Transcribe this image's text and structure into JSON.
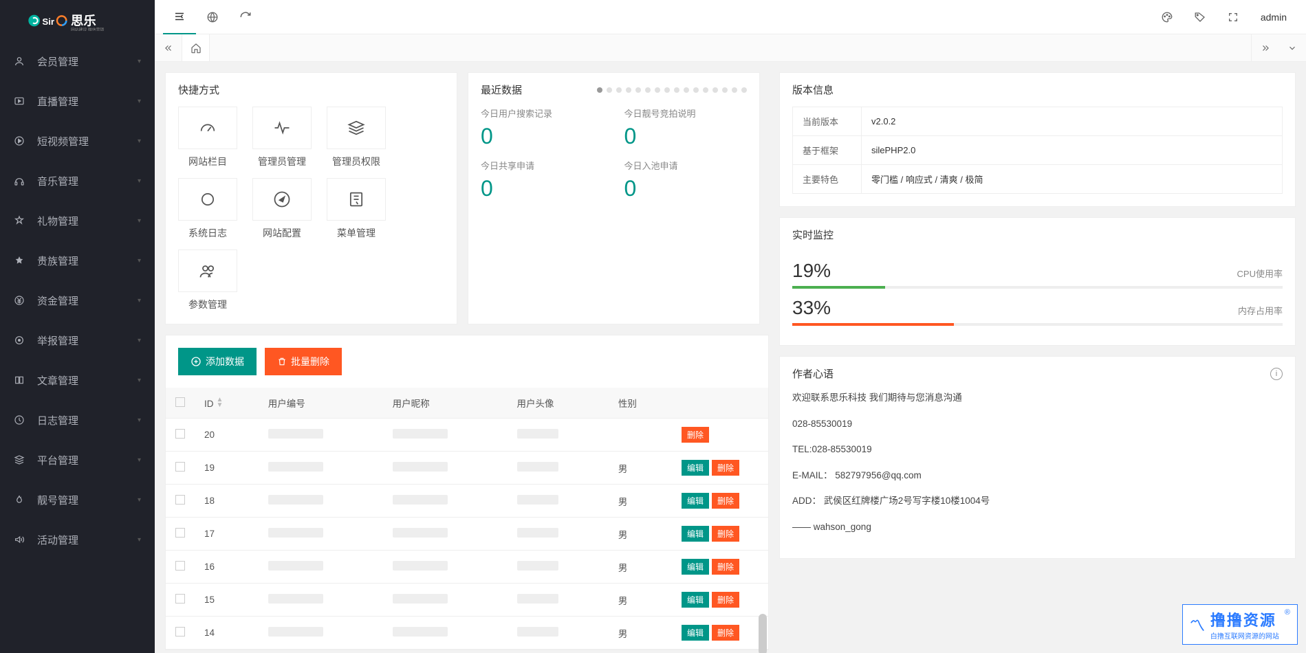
{
  "brand": {
    "name": "思乐",
    "sub": "网站建设 微信营销"
  },
  "nav": [
    {
      "icon": "user",
      "label": "会员管理"
    },
    {
      "icon": "play",
      "label": "直播管理"
    },
    {
      "icon": "video",
      "label": "短视频管理"
    },
    {
      "icon": "music",
      "label": "音乐管理"
    },
    {
      "icon": "gift",
      "label": "礼物管理"
    },
    {
      "icon": "star",
      "label": "贵族管理"
    },
    {
      "icon": "yen",
      "label": "资金管理"
    },
    {
      "icon": "report",
      "label": "举报管理"
    },
    {
      "icon": "article",
      "label": "文章管理"
    },
    {
      "icon": "log",
      "label": "日志管理"
    },
    {
      "icon": "platform",
      "label": "平台管理"
    },
    {
      "icon": "fire",
      "label": "靓号管理"
    },
    {
      "icon": "sound",
      "label": "活动管理"
    }
  ],
  "topbar": {
    "user": "admin"
  },
  "quick": {
    "title": "快捷方式",
    "items": [
      {
        "label": "网站栏目",
        "icon": "gauge"
      },
      {
        "label": "管理员管理",
        "icon": "pulse"
      },
      {
        "label": "管理员权限",
        "icon": "layers"
      },
      {
        "label": "系统日志",
        "icon": "circle"
      },
      {
        "label": "网站配置",
        "icon": "compass"
      },
      {
        "label": "菜单管理",
        "icon": "note"
      },
      {
        "label": "参数管理",
        "icon": "users"
      }
    ]
  },
  "recent": {
    "title": "最近数据",
    "cells": [
      {
        "label": "今日用户搜索记录",
        "value": "0"
      },
      {
        "label": "今日靓号竞拍说明",
        "value": "0"
      },
      {
        "label": "今日共享申请",
        "value": "0"
      },
      {
        "label": "今日入池申请",
        "value": "0"
      }
    ]
  },
  "version": {
    "title": "版本信息",
    "rows": [
      {
        "k": "当前版本",
        "v": "v2.0.2"
      },
      {
        "k": "基于框架",
        "v": "silePHP2.0"
      },
      {
        "k": "主要特色",
        "v": "零门槛 / 响应式 / 清爽 / 极简"
      }
    ]
  },
  "monitor": {
    "title": "实时监控",
    "items": [
      {
        "value": "19%",
        "label": "CPU使用率",
        "pct": 19,
        "color": "#4caf50"
      },
      {
        "value": "33%",
        "label": "内存占用率",
        "pct": 33,
        "color": "#ff5722"
      }
    ]
  },
  "author": {
    "title": "作者心语",
    "lines": [
      "欢迎联系思乐科技 我们期待与您消息沟通",
      "028-85530019",
      "TEL:028-85530019",
      "E-MAIL： 582797956@qq.com",
      "ADD： 武侯区红牌楼广场2号写字楼10楼1004号",
      "—— wahson_gong"
    ]
  },
  "data_table": {
    "add_btn": "添加数据",
    "del_btn": "批量删除",
    "columns": [
      "ID",
      "用户编号",
      "用户昵称",
      "用户头像",
      "性别"
    ],
    "rows": [
      {
        "id": "20",
        "gender": "",
        "edit": false
      },
      {
        "id": "19",
        "gender": "男",
        "edit": true
      },
      {
        "id": "18",
        "gender": "男",
        "edit": true
      },
      {
        "id": "17",
        "gender": "男",
        "edit": true
      },
      {
        "id": "16",
        "gender": "男",
        "edit": true
      },
      {
        "id": "15",
        "gender": "男",
        "edit": true
      },
      {
        "id": "14",
        "gender": "男",
        "edit": true
      }
    ],
    "edit_label": "编辑",
    "delete_label": "删除"
  },
  "watermark": {
    "big": "撸撸资源",
    "small": "白撸互联网资源的网站"
  }
}
